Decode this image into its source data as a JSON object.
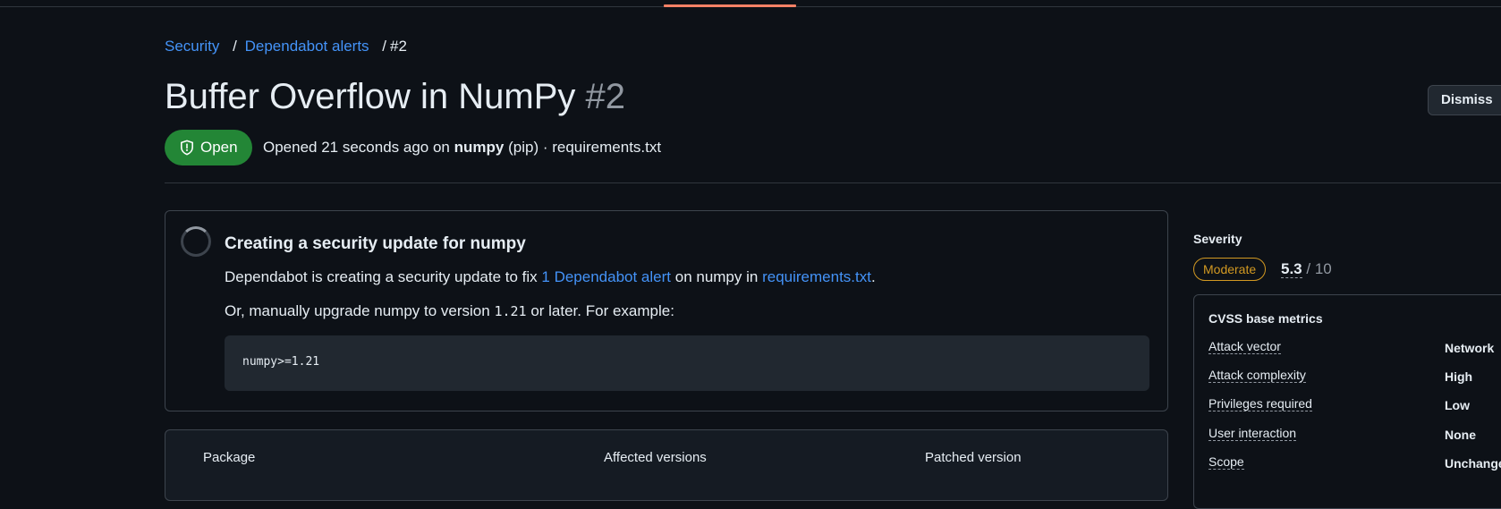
{
  "breadcrumb": {
    "items": [
      "Security",
      "Dependabot alerts"
    ],
    "separator": "/",
    "current": "#2"
  },
  "alert": {
    "title": "Buffer Overflow in NumPy",
    "number": "#2",
    "dismiss_label": "Dismiss",
    "state": "Open",
    "state_icon": "shield-icon",
    "opened_prefix": "Opened 21 seconds ago on",
    "package": "numpy",
    "ecosystem_manifest": "(pip) · requirements.txt"
  },
  "update": {
    "title": "Creating a security update for numpy",
    "desc_prefix": "Dependabot is creating a security update to fix",
    "desc_link": "1 Dependabot alert",
    "desc_middle": "on numpy in",
    "desc_file_link": "requirements.txt",
    "desc_end": ".",
    "manual_prefix": "Or, manually upgrade numpy to version",
    "manual_version": "1.21",
    "manual_suffix": "or later. For example:",
    "code": "numpy>=1.21"
  },
  "package_table": {
    "headers": [
      "Package",
      "Affected versions",
      "Patched version"
    ]
  },
  "severity": {
    "heading": "Severity",
    "level": "Moderate",
    "score": "5.3",
    "max": "/ 10"
  },
  "cvss": {
    "title": "CVSS base metrics",
    "metrics": [
      {
        "name": "Attack vector",
        "value": "Network"
      },
      {
        "name": "Attack complexity",
        "value": "High"
      },
      {
        "name": "Privileges required",
        "value": "Low"
      },
      {
        "name": "User interaction",
        "value": "None"
      },
      {
        "name": "Scope",
        "value": "Unchanged"
      }
    ]
  },
  "colors": {
    "background": "#0d1117",
    "link": "#4493f8",
    "open_green": "#238636",
    "moderate": "#d29922",
    "border": "#3d444d"
  }
}
